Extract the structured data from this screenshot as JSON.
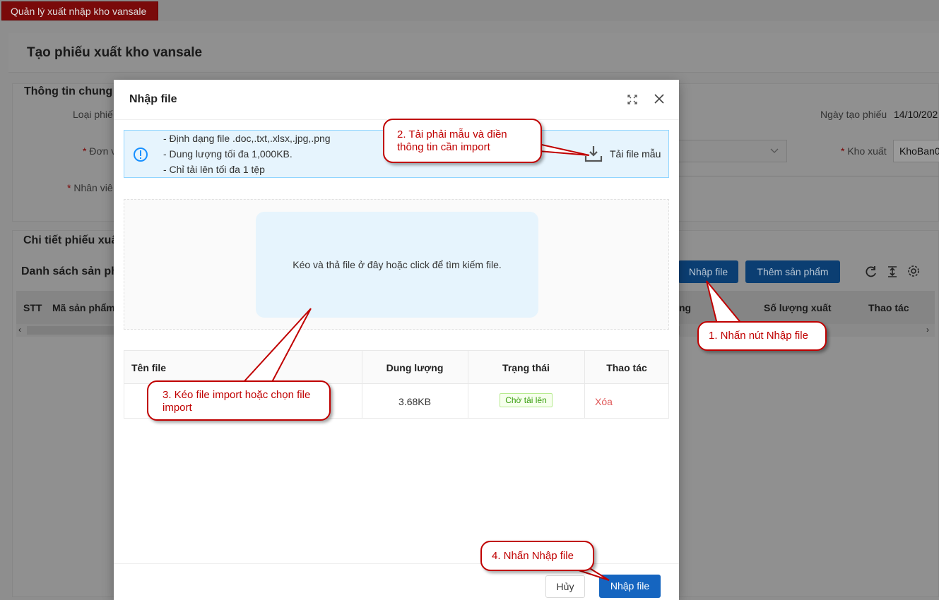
{
  "app": {
    "active_tab": "Quản lý xuất nhập kho vansale",
    "page_title": "Tạo phiếu xuất kho vansale"
  },
  "background": {
    "general_section_title": "Thông tin chung",
    "label_loai_phieu": "Loại phiế",
    "label_don": "Đơn v",
    "label_nhan_vien": "Nhân viê",
    "label_ngay_tao": "Ngày tạo phiếu",
    "ngay_tao_value": "14/10/202",
    "label_kho_xuat": "Kho xuất",
    "kho_xuat_value": "KhoBan0",
    "detail_section_title": "Chi tiết phiếu xuấ",
    "list_title": "Danh sách sản ph",
    "btn_nhap_file": "Nhập file",
    "btn_them_san_pham": "Thêm sản phẩm",
    "columns": {
      "stt": "STT",
      "ma_san_pham": "Mã sản phẩm",
      "partial": "ng",
      "so_luong_xuat": "Số lượng xuất",
      "thao_tac": "Thao tác"
    }
  },
  "modal": {
    "title": "Nhập file",
    "info_lines": [
      "- Định dạng file .doc,.txt,.xlsx,.jpg,.png",
      "- Dung lượng tối đa 1,000KB.",
      "- Chỉ tải lên tối đa 1 tệp"
    ],
    "download_template_label": "Tải file mẫu",
    "dropzone_text": "Kéo và thả file ở đây hoặc click để tìm kiếm file.",
    "table": {
      "headers": [
        "Tên file",
        "Dung lượng",
        "Trạng thái",
        "Thao tác"
      ],
      "rows": [
        {
          "name": "",
          "size": "3.68KB",
          "status": "Chờ tải lên",
          "action": "Xóa"
        }
      ]
    },
    "cancel_label": "Hủy",
    "submit_label": "Nhập file"
  },
  "callouts": {
    "step1": "1. Nhấn nút Nhập file",
    "step2": "2. Tải phải mẫu và điền thông tin cần import",
    "step3": "3. Kéo file import hoặc chọn file import",
    "step4": "4. Nhấn Nhập file"
  },
  "colors": {
    "accent_blue": "#1565c0",
    "callout_red": "#c00000",
    "brand_red": "#8b0000",
    "success_green": "#389e0d",
    "danger_text": "#e05a5a"
  }
}
